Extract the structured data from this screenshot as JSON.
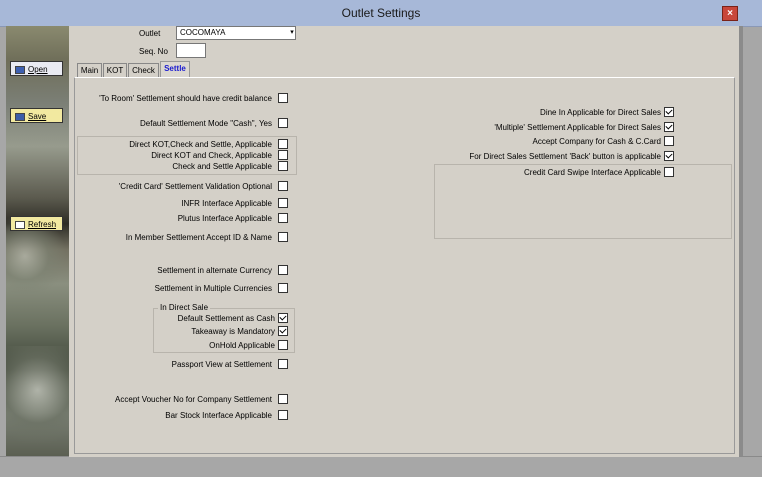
{
  "window": {
    "title": "Outlet Settings",
    "close_symbol": "×"
  },
  "sidebar": {
    "open_label": "Open",
    "save_label": "Save",
    "refresh_label": "Refresh"
  },
  "header": {
    "outlet_label": "Outlet",
    "outlet_value": "COCOMAYA",
    "seq_label": "Seq. No",
    "seq_value": ""
  },
  "tabs": [
    {
      "label": "Main",
      "active": false
    },
    {
      "label": "KOT",
      "active": false
    },
    {
      "label": "Check",
      "active": false
    },
    {
      "label": "Settle",
      "active": true
    }
  ],
  "left_settings": [
    {
      "label": "'To Room' Settlement should have credit balance",
      "checked": false
    },
    {
      "label": "Default Settlement Mode \"Cash\", Yes",
      "checked": false
    },
    {
      "label": "Direct KOT,Check and Settle, Applicable",
      "checked": false
    },
    {
      "label": "Direct KOT and Check, Applicable",
      "checked": false
    },
    {
      "label": "Check and Settle Applicable",
      "checked": false
    },
    {
      "label": "'Credit Card' Settlement Validation Optional",
      "checked": false
    },
    {
      "label": "INFR Interface Applicable",
      "checked": false
    },
    {
      "label": "Plutus Interface Applicable",
      "checked": false
    },
    {
      "label": "In Member Settlement Accept ID & Name",
      "checked": false
    },
    {
      "label": "Settlement in alternate Currency",
      "checked": false
    },
    {
      "label": "Settlement in Multiple Currencies",
      "checked": false
    }
  ],
  "direct_sale": {
    "title": "In Direct Sale",
    "items": [
      {
        "label": "Default Settlement as Cash",
        "checked": true
      },
      {
        "label": "Takeaway is Mandatory",
        "checked": true
      },
      {
        "label": "OnHold Applicable",
        "checked": false
      }
    ]
  },
  "bottom_settings": [
    {
      "label": "Passport View at Settlement",
      "checked": false
    },
    {
      "label": "Accept Voucher No for Company Settlement",
      "checked": false
    },
    {
      "label": "Bar Stock Interface Applicable",
      "checked": false
    }
  ],
  "right_settings": [
    {
      "label": "Dine In Applicable for Direct Sales",
      "checked": true
    },
    {
      "label": "'Multiple' Settlement Applicable for Direct Sales",
      "checked": true
    },
    {
      "label": "Accept Company for Cash & C.Card",
      "checked": false
    },
    {
      "label": "For Direct Sales Settlement 'Back' button is applicable",
      "checked": true
    },
    {
      "label": "Credit Card Swipe Interface Applicable",
      "checked": false
    }
  ]
}
